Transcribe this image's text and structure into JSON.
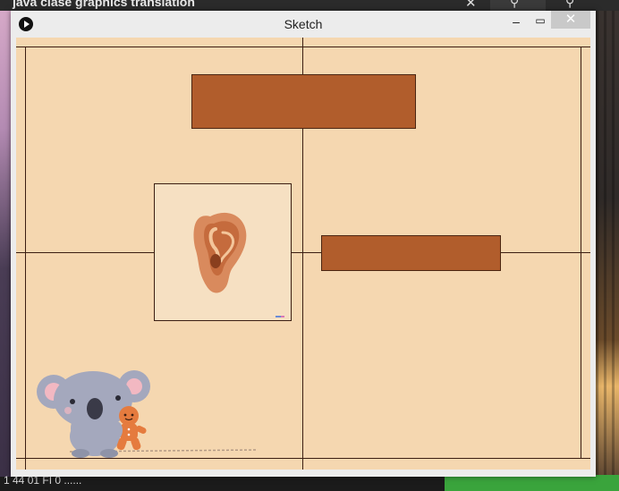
{
  "background": {
    "browser_title": "java clase graphics translation",
    "close_glyph": "✕",
    "search_glyph": "⚲",
    "pin_glyph": "⚲",
    "taskbar_text": "1 44 01 FI 0 ......"
  },
  "window": {
    "title": "Sketch",
    "minimize_glyph": "–",
    "maximize_glyph": "▭",
    "close_glyph": "✕"
  },
  "canvas": {
    "background_color": "#f5d7b0",
    "line_color": "#3b1e12",
    "box_color": "#b15d2c",
    "images": [
      {
        "name": "ear",
        "description_icon": "ear-icon"
      },
      {
        "name": "koala-with-gingerbread",
        "description_icon": "koala-sticker-icon"
      }
    ]
  }
}
